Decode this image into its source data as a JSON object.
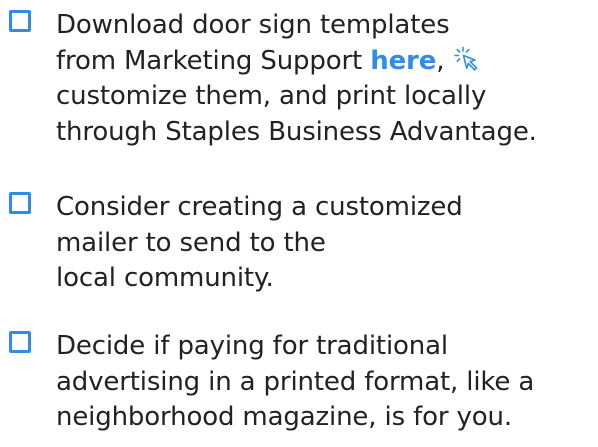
{
  "colors": {
    "accent": "#2f8ce8",
    "text": "#222222",
    "background": "#ffffff"
  },
  "checklist": {
    "items": [
      {
        "checked": false,
        "lines": [
          "Download door sign templates",
          "from Marketing Support ",
          "here",
          ",",
          "customize them, and print locally",
          "through Staples Business Advantage."
        ],
        "link_icon": "cursor-click-icon"
      },
      {
        "checked": false,
        "lines": [
          "Consider creating a customized",
          "mailer to send to the",
          "local community."
        ]
      },
      {
        "checked": false,
        "lines": [
          "Decide if paying for traditional",
          "advertising in a printed format, like a",
          "neighborhood magazine, is for you."
        ]
      }
    ]
  }
}
